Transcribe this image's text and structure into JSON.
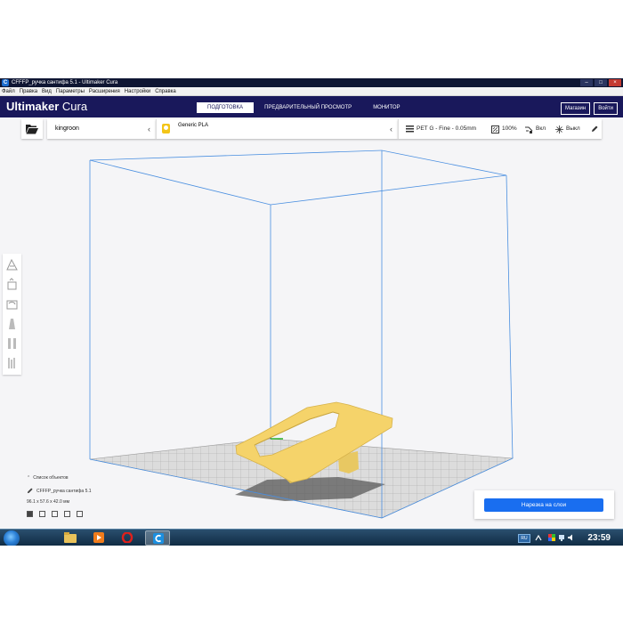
{
  "window": {
    "title": "CFFFP_ручка сантифа 5.1 - Ultimaker Cura",
    "icon_letter": "C"
  },
  "menu": [
    "Файл",
    "Правка",
    "Вид",
    "Параметры",
    "Расширения",
    "Настройки",
    "Справка"
  ],
  "header": {
    "brand_bold": "Ultimaker",
    "brand_light": "Cura",
    "stages": [
      {
        "label": "ПОДГОТОВКА",
        "active": true
      },
      {
        "label": "ПРЕДВАРИТЕЛЬНЫЙ ПРОСМОТР",
        "active": false
      },
      {
        "label": "МОНИТОР",
        "active": false
      }
    ],
    "marketplace_label": "Магазин",
    "signin_label": "Войти"
  },
  "toolbar": {
    "printer_name": "kingroon",
    "material_name": "Generic PLA",
    "profile": "PET G - Fine - 0.05mm",
    "infill": "100%",
    "support": "Вкл",
    "adhesion": "Выкл"
  },
  "object": {
    "list_label": "Список объектов",
    "name": "CFFFP_ручка сантифа 5.1",
    "dimensions": "96.1 x 57.6 x 42.0 мм"
  },
  "slice_button_label": "Нарезка на слои",
  "taskbar": {
    "language": "RU",
    "time": "23:59"
  },
  "colors": {
    "header_bg": "#19185b",
    "accent": "#196ef0",
    "model_yellow": "#f5d36a",
    "build_volume_line": "#4a8fe0"
  }
}
